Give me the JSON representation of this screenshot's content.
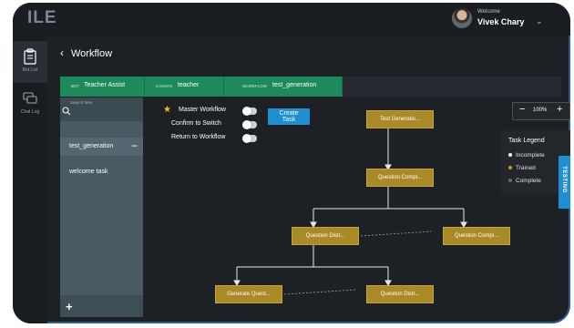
{
  "app": {
    "logo": "ILE"
  },
  "user": {
    "welcome": "Welcome",
    "name": "Vivek Chary"
  },
  "nav": [
    {
      "label": "Bot List",
      "icon": "clipboard-icon"
    },
    {
      "label": "Chat Log",
      "icon": "chat-bubbles-icon"
    }
  ],
  "page": {
    "title": "Workflow"
  },
  "tabs": [
    {
      "key": "BOT",
      "value": "Teacher Assist"
    },
    {
      "key": "CANVAS",
      "value": "teacher"
    },
    {
      "key": "WORKFLOW",
      "value": "test_generation"
    }
  ],
  "panel": {
    "search_label": "Search here",
    "items": [
      "test_generation",
      "welcome task"
    ]
  },
  "options": [
    {
      "label": "Master Workflow",
      "on": false
    },
    {
      "label": "Confirm to Switch",
      "on": false
    },
    {
      "label": "Return to Workflow",
      "on": false
    }
  ],
  "create_task": "Create Task",
  "zoom": {
    "minus": "−",
    "value": "100%",
    "plus": "+"
  },
  "legend": {
    "title": "Task Legend",
    "items": [
      {
        "label": "Incomplete",
        "color": "#ffffff"
      },
      {
        "label": "Trained",
        "color": "#c59a2b"
      },
      {
        "label": "Complete",
        "color": "#2e8b57"
      }
    ]
  },
  "nodes": [
    "Test Generatio...",
    "Question Compl...",
    "Question Distr...",
    "Question Compl...",
    "Generate Quest...",
    "Question Distr..."
  ],
  "ribbon": "TESTING"
}
